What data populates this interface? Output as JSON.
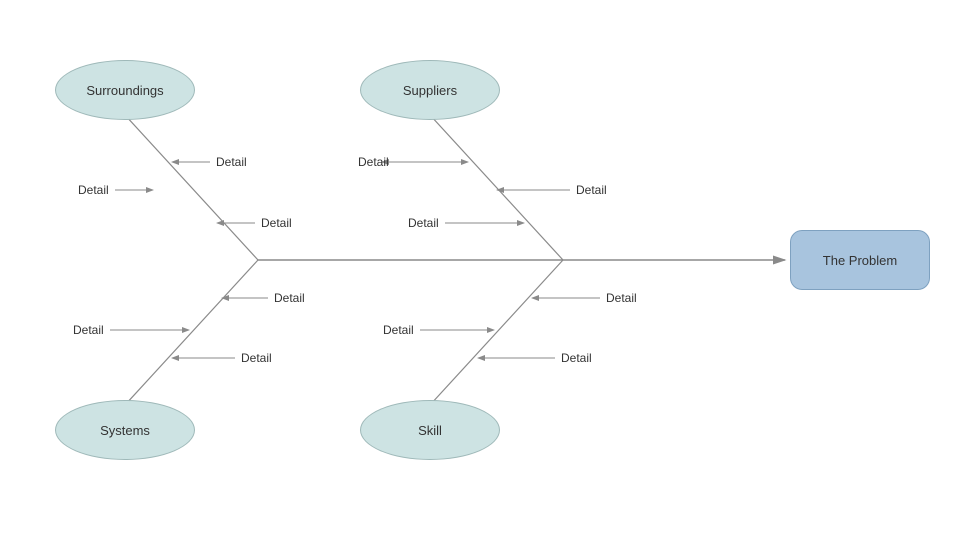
{
  "problem": {
    "label": "The Problem"
  },
  "causes": {
    "surroundings": {
      "label": "Surroundings",
      "details": [
        "Detail",
        "Detail",
        "Detail"
      ]
    },
    "suppliers": {
      "label": "Suppliers",
      "details": [
        "Detail",
        "Detail",
        "Detail"
      ]
    },
    "systems": {
      "label": "Systems",
      "details": [
        "Detail",
        "Detail",
        "Detail"
      ]
    },
    "skill": {
      "label": "Skill",
      "details": [
        "Detail",
        "Detail",
        "Detail"
      ]
    }
  },
  "colors": {
    "ellipse_fill": "#cde3e3",
    "ellipse_stroke": "#9fb9b9",
    "problem_fill": "#a8c4de",
    "problem_stroke": "#7ea1c0",
    "line": "#8a8a8a"
  }
}
